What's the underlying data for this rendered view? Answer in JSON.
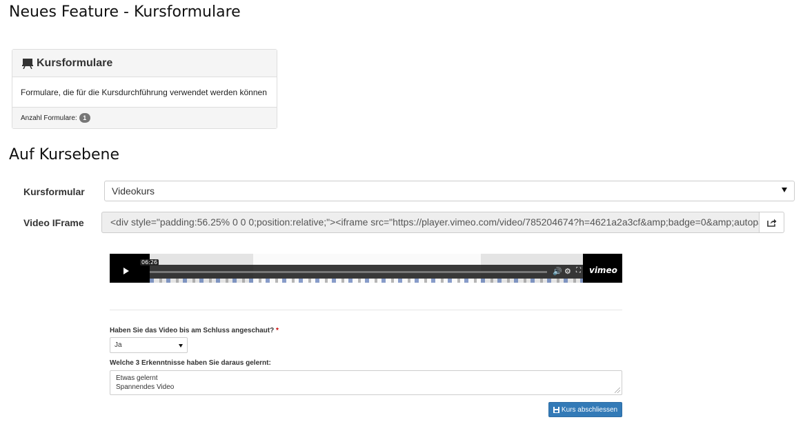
{
  "headings": {
    "feature": "Neues Feature - Kursformulare",
    "course_level": "Auf Kursebene"
  },
  "panel": {
    "icon": "presentation-board-icon",
    "title": "Kursformulare",
    "description": "Formulare, die für die Kursdurchführung verwendet werden können",
    "count_label": "Anzahl Formulare:",
    "count": "1"
  },
  "form": {
    "kursformular_label": "Kursformular",
    "kursformular_value": "Videokurs",
    "video_iframe_label": "Video IFrame",
    "video_iframe_value": "<div style=\"padding:56.25% 0 0 0;position:relative;\"><iframe src=\"https://player.vimeo.com/video/785204674?h=4621a2a3cf&amp;badge=0&amp;autopause",
    "share_icon": "share-icon"
  },
  "video": {
    "time": "06:26",
    "logo": "vimeo",
    "controls": [
      "volume-icon",
      "settings-icon",
      "fullscreen-icon"
    ]
  },
  "preview_form": {
    "question1": "Haben Sie das Video bis am Schluss angeschaut?",
    "required_mark": "*",
    "answer1": "Ja",
    "question2": "Welche 3 Erkenntnisse haben Sie daraus gelernt:",
    "answer2_lines": [
      "Etwas gelernt",
      "Spannendes Video"
    ],
    "finish_button": "Kurs abschliessen"
  },
  "colors": {
    "primary_button": "#337ab7",
    "badge": "#777777",
    "required": "#cc0000"
  }
}
